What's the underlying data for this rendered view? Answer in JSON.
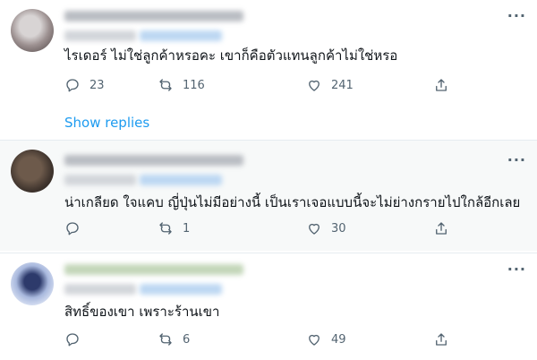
{
  "tweets": [
    {
      "text": "ไรเดอร์ ไม่ใช่ลูกค้าหรอคะ เขาก็คือตัวแทนลูกค้าไม่ใช่หรอ",
      "reply_count": "23",
      "retweet_count": "116",
      "like_count": "241",
      "more_icon": "more-icon",
      "show_replies": "Show replies"
    },
    {
      "text": "น่าเกลียด ใจแคบ ญี่ปุ่นไม่มีอย่างนี้ เป็นเราเจอแบบนี้จะไม่ย่างกรายไปใกล้อีกเลย",
      "reply_count": "",
      "retweet_count": "1",
      "like_count": "30"
    },
    {
      "text": "สิทธิ์ของเขา เพราะร้านเขา",
      "reply_count": "",
      "retweet_count": "6",
      "like_count": "49"
    }
  ],
  "colors": {
    "link": "#1d9bf0",
    "icon": "#536471",
    "highlight_background": "#f7f9f9"
  }
}
